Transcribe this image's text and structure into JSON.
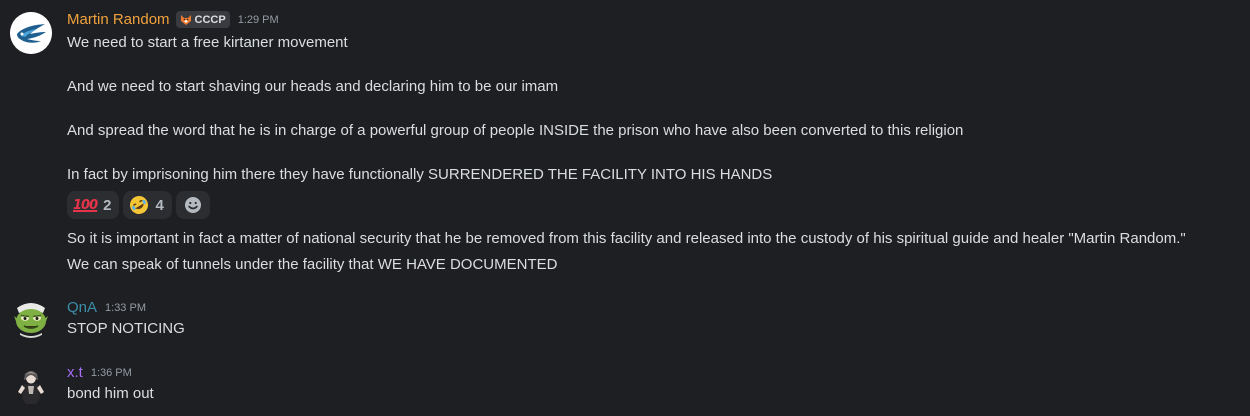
{
  "messages": [
    {
      "username": "Martin Random",
      "username_color": "#f0a13c",
      "tag": "CCCP",
      "tag_icon": "fox-icon",
      "timestamp": "1:29 PM",
      "lines": [
        "We need to start a free kirtaner movement",
        "And we need to start shaving our heads and declaring him to be our imam",
        "And spread the word that he is in charge of a powerful group of people INSIDE the prison who have also been converted to this religion",
        "In fact by imprisoning him there they have functionally SURRENDERED THE FACILITY INTO HIS HANDS",
        "So it is important in fact a matter of national security that he be removed from this facility and released into the custody of his spiritual guide and healer \"Martin Random.\"",
        "We can speak of tunnels under the facility that WE HAVE DOCUMENTED"
      ],
      "reactions": [
        {
          "emoji": "hundred-points-emoji",
          "glyph": "100",
          "count": "2"
        },
        {
          "emoji": "rolling-laughing-emoji",
          "count": "4"
        }
      ],
      "add_reaction_icon": "smiley-add-reaction-icon"
    },
    {
      "username": "QnA",
      "username_color": "#3b8ea8",
      "timestamp": "1:33 PM",
      "lines": [
        "STOP NOTICING"
      ]
    },
    {
      "username": "x.t",
      "username_color": "#a66cf5",
      "timestamp": "1:36 PM",
      "lines": [
        "bond him out"
      ]
    }
  ]
}
